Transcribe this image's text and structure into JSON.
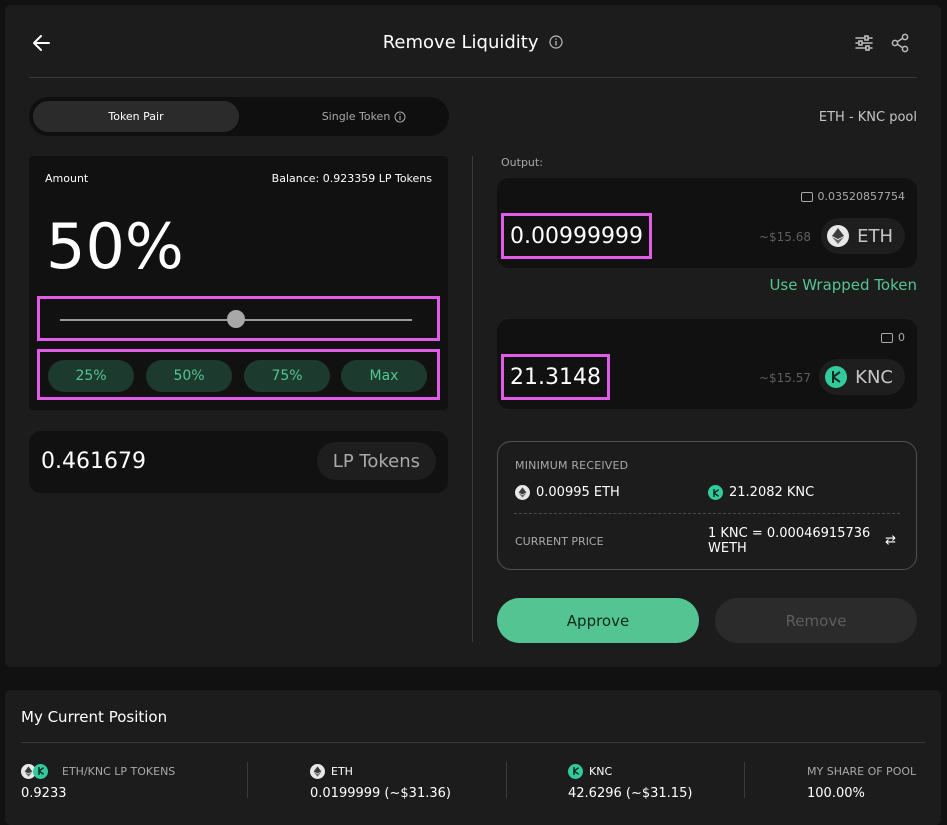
{
  "header": {
    "title": "Remove Liquidity"
  },
  "tabs": [
    {
      "label": "Token Pair"
    },
    {
      "label": "Single Token"
    }
  ],
  "pool": {
    "label": "ETH - KNC pool"
  },
  "amount": {
    "label": "Amount",
    "balance": "Balance: 0.923359 LP Tokens",
    "percent": "50%",
    "slider_fraction": 0.5,
    "presets": [
      "25%",
      "50%",
      "75%",
      "Max"
    ]
  },
  "lp": {
    "value": "0.461679",
    "unit": "LP Tokens"
  },
  "output": {
    "label": "Output:",
    "tokens": [
      {
        "symbol": "ETH",
        "amount": "0.00999999",
        "usd": "~$15.68",
        "wallet_balance": "0.03520857754"
      },
      {
        "symbol": "KNC",
        "amount": "21.3148",
        "usd": "~$15.57",
        "wallet_balance": "0"
      }
    ],
    "wrapped_link": "Use Wrapped Token"
  },
  "summary": {
    "minimum_label": "MINIMUM RECEIVED",
    "min_eth": "0.00995 ETH",
    "min_knc": "21.2082 KNC",
    "price_label": "CURRENT PRICE",
    "price_value": "1 KNC = 0.00046915736 WETH",
    "swap_glyph": "⇄"
  },
  "actions": {
    "approve": "Approve",
    "remove": "Remove"
  },
  "position": {
    "title": "My Current Position",
    "columns": [
      {
        "label": "ETH/KNC LP TOKENS",
        "value": "0.9233"
      },
      {
        "label": "ETH",
        "value": "0.0199999 (~$31.36)"
      },
      {
        "label": "KNC",
        "value": "42.6296 (~$31.15)"
      },
      {
        "label": "MY SHARE OF POOL",
        "value": "100.00%"
      }
    ]
  },
  "colors": {
    "accent": "#54c592",
    "highlight": "#e05ce8",
    "background": "#1c1c1c"
  },
  "icons": [
    "arrow-left-icon",
    "info-icon",
    "sliders-icon",
    "share-icon",
    "wallet-icon",
    "eth-icon",
    "knc-icon",
    "swap-icon"
  ]
}
